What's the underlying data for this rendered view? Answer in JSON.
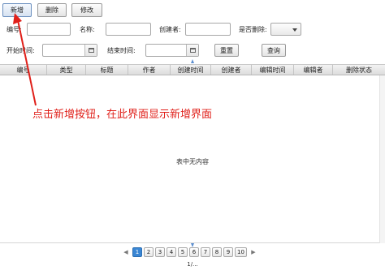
{
  "toolbar": {
    "add": "新增",
    "delete": "删除",
    "edit": "修改"
  },
  "filters": {
    "id_label": "编号:",
    "name_label": "名称:",
    "creator_label": "创建者:",
    "deleted_label": "是否删除:",
    "start_label": "开始时间:",
    "end_label": "结束时间:",
    "reset": "重置",
    "query": "查询"
  },
  "table": {
    "columns": [
      "编号",
      "类型",
      "标题",
      "作者",
      "创建时间",
      "创建者",
      "编辑时间",
      "编辑者",
      "删除状态"
    ],
    "empty": "表中无内容"
  },
  "annotation": {
    "text": "点击新增按钮，在此界面显示新增界面",
    "color": "#e0201a"
  },
  "pagination": {
    "prev_icon": "chevron-left-icon",
    "pages": [
      "1",
      "2",
      "3",
      "4",
      "5",
      "6",
      "7",
      "8",
      "9",
      "10"
    ],
    "active": "1",
    "next_icon": "chevron-right-icon",
    "status": "1/..."
  },
  "colors": {
    "accent": "#3a86d4",
    "annotation": "#e0201a"
  }
}
